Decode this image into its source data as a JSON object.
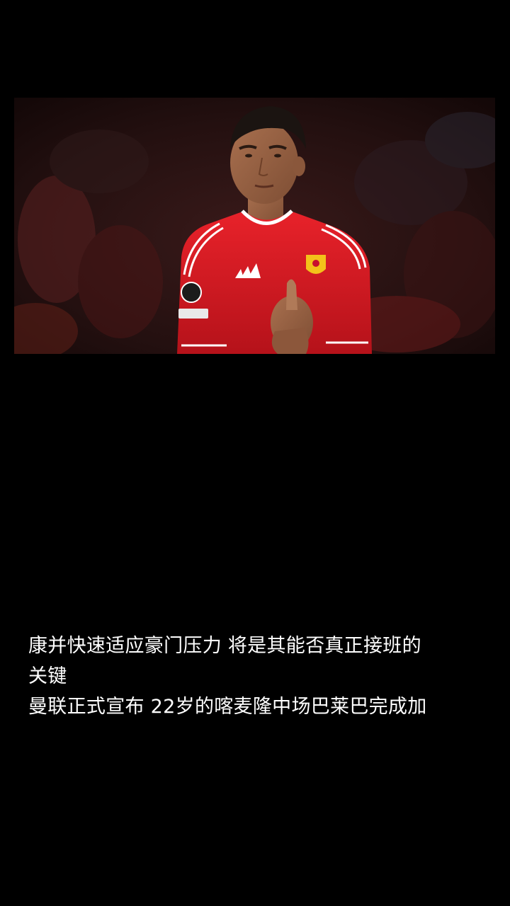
{
  "photo": {
    "alt": "Casemiro applauding in a red Manchester United shirt",
    "icon": "player-photo",
    "colors": {
      "background": "#000000",
      "shirt": "#d81920",
      "crowd": "#2a1414"
    }
  },
  "caption": {
    "lines": [
      "康并快速适应豪门压力 将是其能否真正接班的",
      "关键",
      "曼联正式宣布 22岁的喀麦隆中场巴莱巴完成加"
    ],
    "color": "#ffffff"
  }
}
